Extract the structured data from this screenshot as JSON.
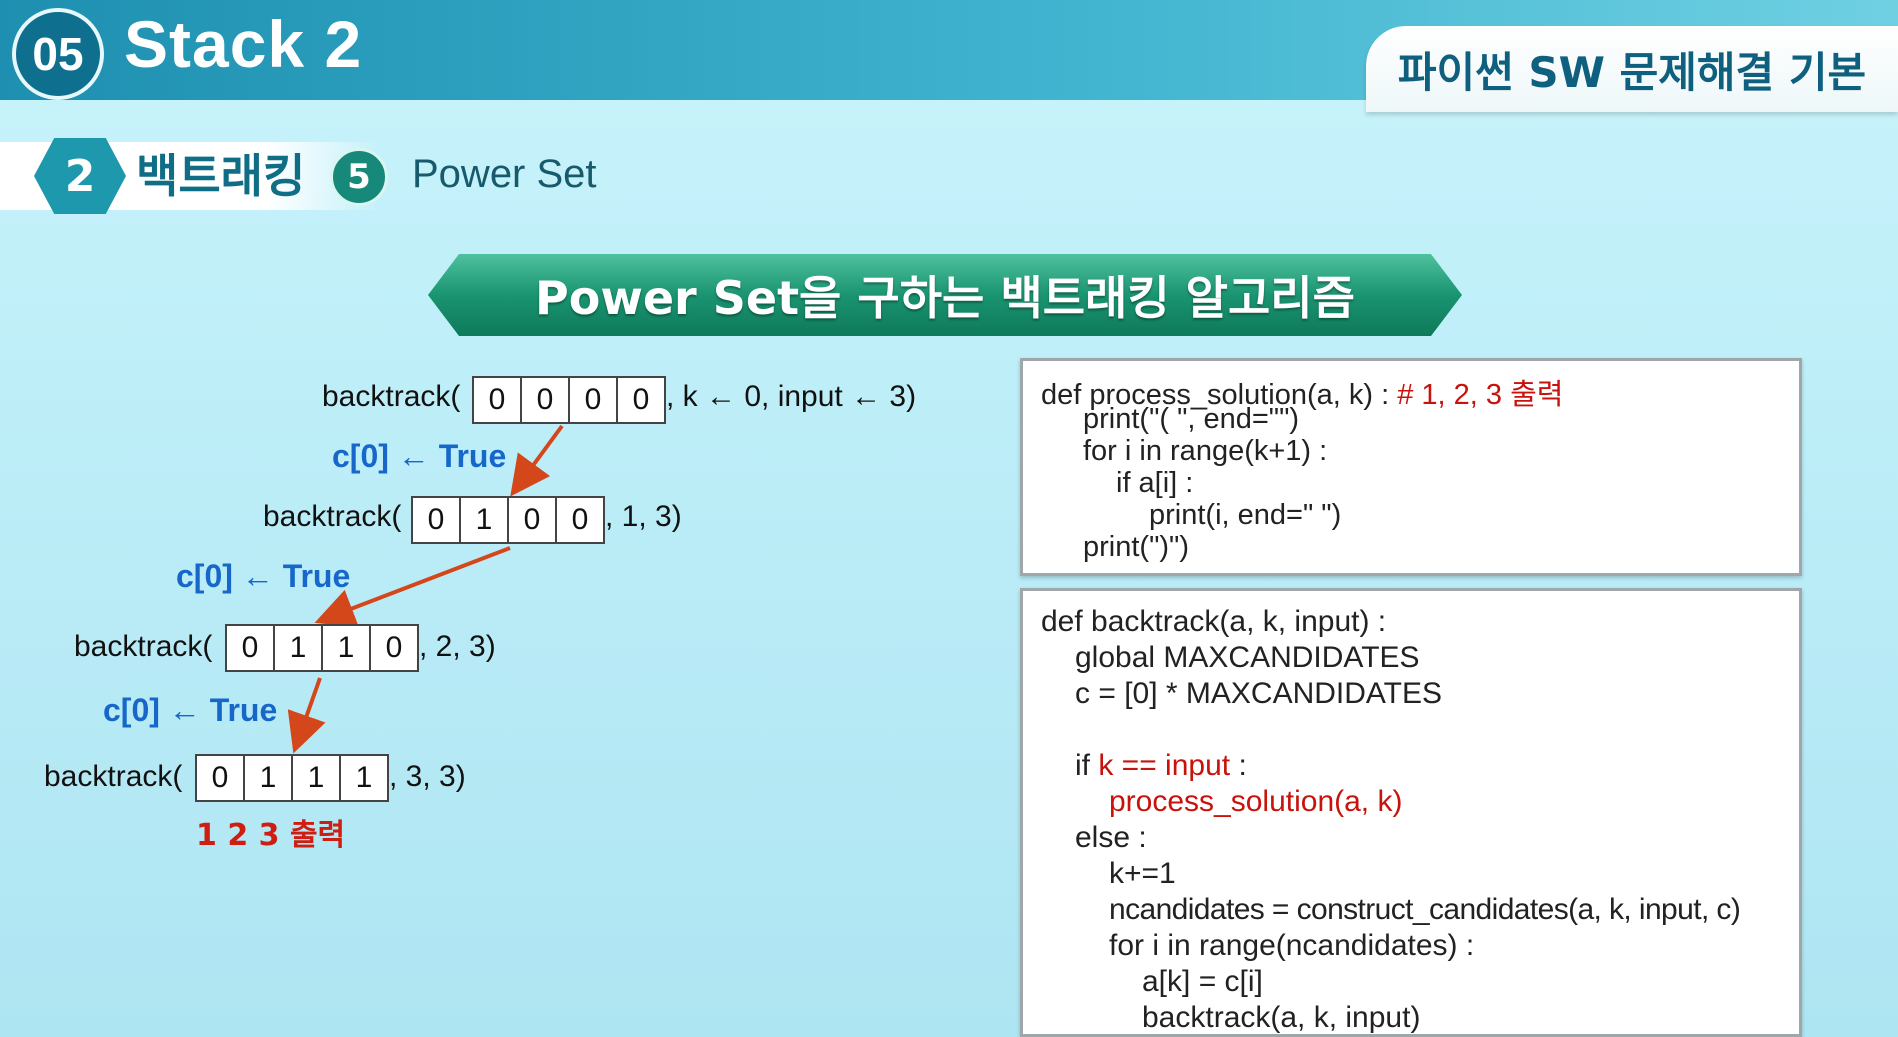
{
  "header": {
    "section_number": "05",
    "title": "Stack 2",
    "course": "파이썬 SW 문제해결 기본"
  },
  "breadcrumb": {
    "step": "2",
    "topic": "백트래킹",
    "sub_step": "5",
    "sub_topic": "Power Set"
  },
  "heading": "Power Set을 구하는 백트래킹 알고리즘",
  "tree": {
    "calls": [
      {
        "prefix": "backtrack(",
        "cells": [
          "0",
          "0",
          "0",
          "0"
        ],
        "suffix": ", k ← 0, input ← 3)"
      },
      {
        "prefix": "backtrack(",
        "cells": [
          "0",
          "1",
          "0",
          "0"
        ],
        "suffix": ", 1, 3)"
      },
      {
        "prefix": "backtrack(",
        "cells": [
          "0",
          "1",
          "1",
          "0"
        ],
        "suffix": ", 2, 3)"
      },
      {
        "prefix": "backtrack(",
        "cells": [
          "0",
          "1",
          "1",
          "1"
        ],
        "suffix": ", 3, 3)"
      }
    ],
    "assignments": [
      "c[0] ← True",
      "c[0] ← True",
      "c[0] ← True"
    ],
    "output_label": "1 2 3 출력"
  },
  "code_process": {
    "lines": [
      {
        "text": "def process_solution(a, k) : ",
        "comment": "# 1, 2, 3 출력"
      },
      {
        "text": "print(\"( \", end=\"\")"
      },
      {
        "text": "for i in range(k+1) :"
      },
      {
        "text": "if a[i] :"
      },
      {
        "text": "print(i, end=\" \")"
      },
      {
        "text": "print(\")\")"
      }
    ]
  },
  "code_backtrack": {
    "lines": [
      {
        "text": "def backtrack(a, k, input) :"
      },
      {
        "text": "global MAXCANDIDATES"
      },
      {
        "text": "c = [0] * MAXCANDIDATES"
      },
      {
        "text": "if ",
        "highlight": "k == input",
        "after": " :"
      },
      {
        "highlight": "process_solution(a, k)"
      },
      {
        "text": "else :"
      },
      {
        "text": "k+=1"
      },
      {
        "text": "ncandidates = construct_candidates(a, k, input, c)"
      },
      {
        "text": "for i in range(ncandidates) :"
      },
      {
        "text": "a[k] = c[i]"
      },
      {
        "text": "backtrack(a, k, input)"
      }
    ]
  },
  "colors": {
    "accent_blue": "#1667c9",
    "accent_red": "#c8120c",
    "arrow": "#d4471b",
    "heading_green": "#1a9471"
  }
}
